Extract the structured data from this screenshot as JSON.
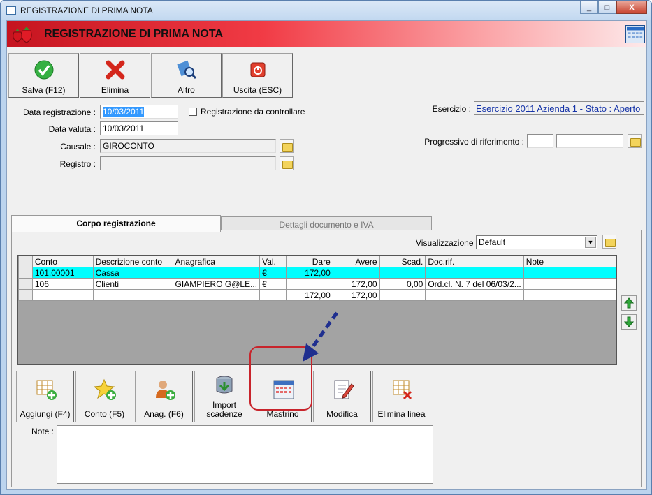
{
  "window": {
    "title": "REGISTRAZIONE DI PRIMA NOTA",
    "minimize": "_",
    "maximize": "□",
    "close": "X"
  },
  "header": {
    "title": "REGISTRAZIONE DI PRIMA NOTA"
  },
  "toolbar": {
    "save": "Salva (F12)",
    "delete": "Elimina",
    "other": "Altro",
    "exit": "Uscita (ESC)"
  },
  "form": {
    "data_registrazione_label": "Data registrazione :",
    "data_registrazione": "10/03/2011",
    "da_controllare_label": "Registrazione da controllare",
    "data_valuta_label": "Data valuta :",
    "data_valuta": "10/03/2011",
    "causale_label": "Causale :",
    "causale": "GIROCONTO",
    "registro_label": "Registro :",
    "registro": "",
    "esercizio_label": "Esercizio :",
    "esercizio": "Esercizio 2011 Azienda 1 - Stato : Aperto",
    "progressivo_label": "Progressivo di riferimento :"
  },
  "tabs": {
    "corpo": "Corpo registrazione",
    "dettagli": "Dettagli documento e IVA"
  },
  "visualizzazione": {
    "label": "Visualizzazione :",
    "value": "Default"
  },
  "grid": {
    "headers": [
      "Conto",
      "Descrizione conto",
      "Anagrafica",
      "Val.",
      "Dare",
      "Avere",
      "Scad.",
      "Doc.rif.",
      "Note"
    ],
    "rows": [
      [
        "101.00001",
        "Cassa",
        "",
        "€",
        "172,00",
        "",
        "",
        "",
        ""
      ],
      [
        "106",
        "Clienti",
        "GIAMPIERO G@LE...",
        "€",
        "",
        "172,00",
        "0,00",
        "Ord.cl. N. 7 del 06/03/2...",
        ""
      ],
      [
        "",
        "",
        "",
        "",
        "172,00",
        "172,00",
        "",
        "",
        ""
      ]
    ]
  },
  "bottom_buttons": {
    "aggiungi": "Aggiungi (F4)",
    "conto": "Conto (F5)",
    "anag": "Anag. (F6)",
    "import": "Import scadenze",
    "mastrino": "Mastrino",
    "modifica": "Modifica",
    "elimina": "Elimina linea"
  },
  "note": {
    "label": "Note :",
    "value": ""
  },
  "colors": {
    "selected_row": "#00ffff",
    "header_red": "#c5141f",
    "highlight": "#c8242b",
    "arrow": "#1f2f8f"
  },
  "icons": [
    "check-icon",
    "delete-x-icon",
    "magnify-icon",
    "power-icon",
    "strawberry-icon",
    "calendar-icon",
    "folder-icon",
    "arrow-up-icon",
    "arrow-down-icon"
  ]
}
